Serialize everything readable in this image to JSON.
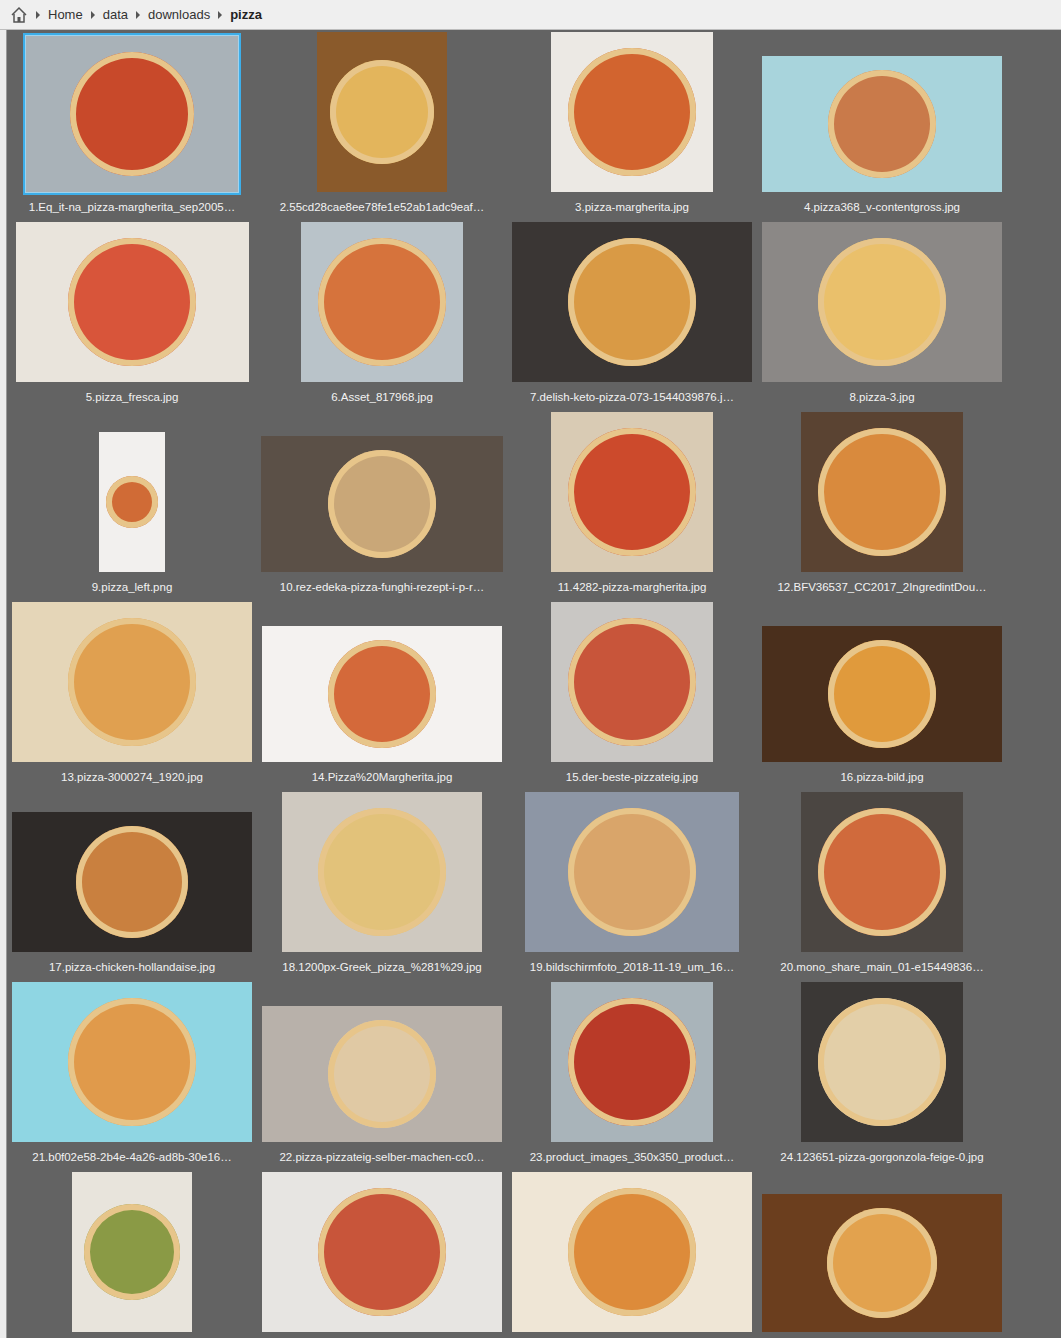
{
  "breadcrumb": [
    {
      "label": "Home",
      "current": false
    },
    {
      "label": "data",
      "current": false
    },
    {
      "label": "downloads",
      "current": false
    },
    {
      "label": "pizza",
      "current": true
    }
  ],
  "items": [
    {
      "label": "1.Eq_it-na_pizza-margherita_sep2005…",
      "selected": true
    },
    {
      "label": "2.55cd28cae8ee78fe1e52ab1adc9eaf…",
      "selected": false
    },
    {
      "label": "3.pizza-margherita.jpg",
      "selected": false
    },
    {
      "label": "4.pizza368_v-contentgross.jpg",
      "selected": false
    },
    {
      "label": "5.pizza_fresca.jpg",
      "selected": false
    },
    {
      "label": "6.Asset_817968.jpg",
      "selected": false
    },
    {
      "label": "7.delish-keto-pizza-073-1544039876.j…",
      "selected": false
    },
    {
      "label": "8.pizza-3.jpg",
      "selected": false
    },
    {
      "label": "9.pizza_left.png",
      "selected": false
    },
    {
      "label": "10.rez-edeka-pizza-funghi-rezept-i-p-r…",
      "selected": false
    },
    {
      "label": "11.4282-pizza-margherita.jpg",
      "selected": false
    },
    {
      "label": "12.BFV36537_CC2017_2IngredintDou…",
      "selected": false
    },
    {
      "label": "13.pizza-3000274_1920.jpg",
      "selected": false
    },
    {
      "label": "14.Pizza%20Margherita.jpg",
      "selected": false
    },
    {
      "label": "15.der-beste-pizzateig.jpg",
      "selected": false
    },
    {
      "label": "16.pizza-bild.jpg",
      "selected": false
    },
    {
      "label": "17.pizza-chicken-hollandaise.jpg",
      "selected": false
    },
    {
      "label": "18.1200px-Greek_pizza_%281%29.jpg",
      "selected": false
    },
    {
      "label": "19.bildschirmfoto_2018-11-19_um_16…",
      "selected": false
    },
    {
      "label": "20.mono_share_main_01-e15449836…",
      "selected": false
    },
    {
      "label": "21.b0f02e58-2b4e-4a26-ad8b-30e16…",
      "selected": false
    },
    {
      "label": "22.pizza-pizzateig-selber-machen-cc0…",
      "selected": false
    },
    {
      "label": "23.product_images_350x350_product…",
      "selected": false
    },
    {
      "label": "24.123651-pizza-gorgonzola-feige-0.jpg",
      "selected": false
    },
    {
      "selected": false
    },
    {
      "selected": false
    },
    {
      "selected": false
    },
    {
      "selected": false
    }
  ]
}
